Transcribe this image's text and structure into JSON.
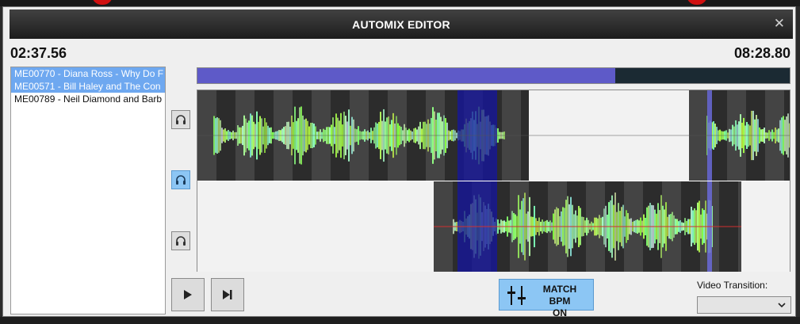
{
  "window": {
    "title": "AUTOMIX EDITOR"
  },
  "times": {
    "elapsed": "02:37.56",
    "total": "08:28.80"
  },
  "tracks": [
    {
      "label": "ME00770 - Diana Ross - Why Do F",
      "selected": true
    },
    {
      "label": "ME00571 - Bill Haley and The Con",
      "selected": true
    },
    {
      "label": "ME00789 - Neil Diamond and Barb",
      "selected": false
    }
  ],
  "progress": {
    "fraction": 0.705
  },
  "transport": {
    "play": "play",
    "next": "skip-next"
  },
  "match_bpm": {
    "line1": "MATCH BPM",
    "line2": "ON"
  },
  "video_transition": {
    "label": "Video Transition:",
    "value": ""
  },
  "colors": {
    "accent": "#8cc6f4",
    "progress": "#5e5ac8",
    "wave_low": "#9cff30",
    "wave_high": "#40e0d0",
    "overlap": "#1414a0"
  }
}
